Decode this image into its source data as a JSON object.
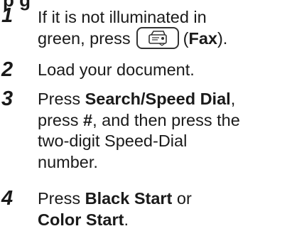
{
  "cut_heading": "p   g",
  "steps": [
    {
      "number": "1",
      "line1": "If it is not illuminated in",
      "line2_prefix": "green, press",
      "button_name": "Fax",
      "line2_open": "(",
      "line2_close": ")."
    },
    {
      "number": "2",
      "text": "Load your document."
    },
    {
      "number": "3",
      "line1_prefix": "Press ",
      "line1_bold": "Search/Speed Dial",
      "line1_suffix": ",",
      "line2_prefix": "press ",
      "line2_bold": "#",
      "line2_suffix": ", and then press the",
      "line3": "two-digit Speed-Dial",
      "line4": "number."
    },
    {
      "number": "4",
      "line1_prefix": "Press ",
      "line1_bold": "Black Start",
      "line1_suffix": " or",
      "line2_bold": "Color Start",
      "line2_suffix": "."
    }
  ],
  "icons": {
    "fax_button": "fax-machine-icon"
  }
}
